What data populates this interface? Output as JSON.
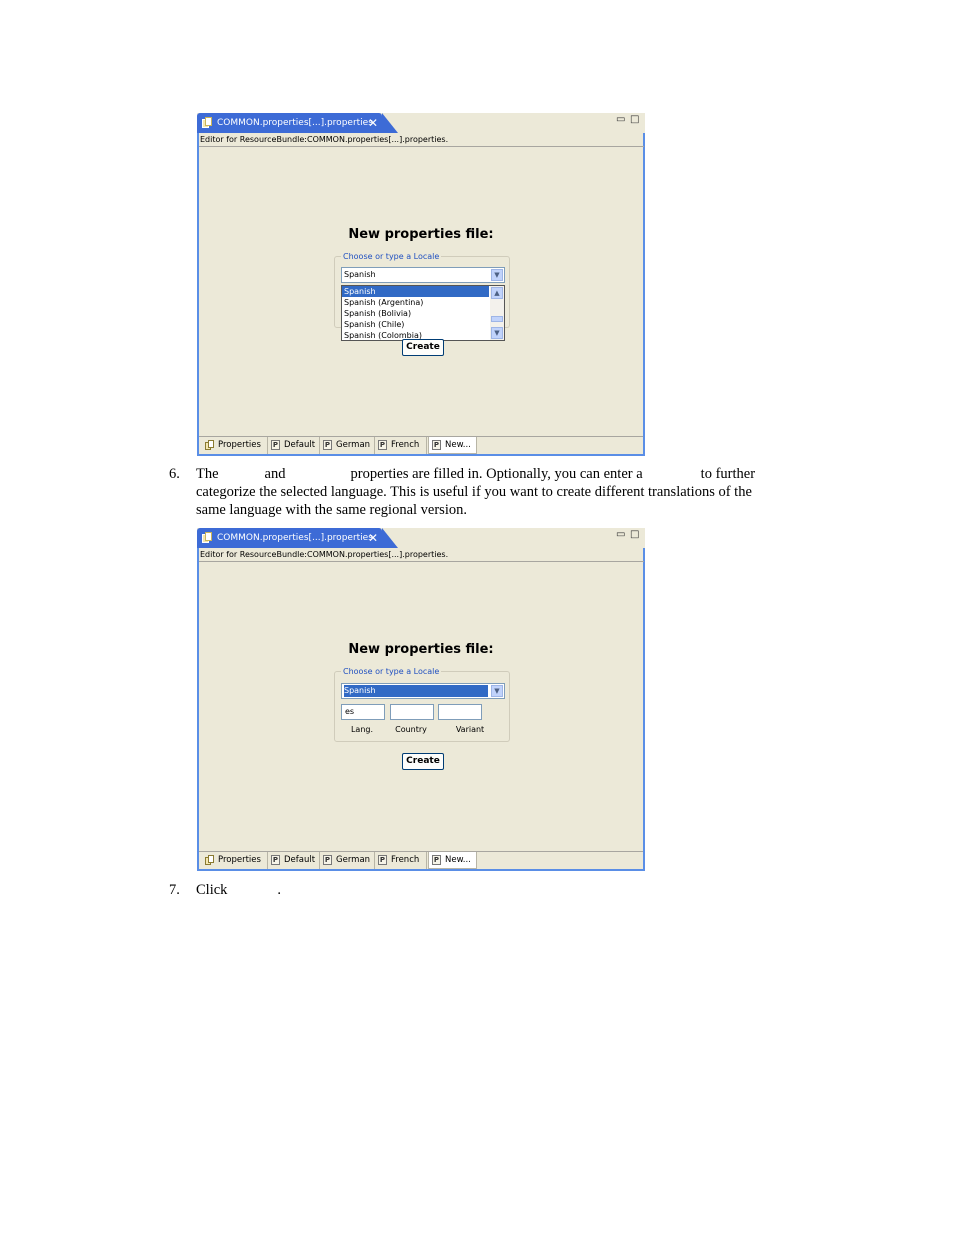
{
  "screenshot_top": {
    "tab_title": "COMMON.properties[...].properties",
    "editor_header": "Editor for ResourceBundle:COMMON.properties[...].properties.",
    "panel_title": "New properties file:",
    "group_label": "Choose or type a Locale",
    "combo_value": "Spanish",
    "dropdown_items": [
      "Spanish",
      "Spanish (Argentina)",
      "Spanish (Bolivia)",
      "Spanish (Chile)",
      "Spanish (Colombia)"
    ],
    "create_button": "Create",
    "bottom_tabs": [
      "Properties",
      "Default",
      "German",
      "French",
      "New..."
    ]
  },
  "step6": {
    "number": "6.",
    "line1_parts": [
      "The",
      "and",
      "properties are filled in.  Optionally, you can enter a",
      "to further"
    ],
    "line2": "categorize the selected language.  This is useful if you want to create different translations of the",
    "line3": "same language with the same regional version."
  },
  "screenshot_bottom": {
    "tab_title": "COMMON.properties[...].properties",
    "editor_header": "Editor for ResourceBundle:COMMON.properties[...].properties.",
    "panel_title": "New properties file:",
    "group_label": "Choose or type a Locale",
    "combo_value": "Spanish",
    "lang_value": "es",
    "country_value": "",
    "variant_value": "",
    "lang_label": "Lang.",
    "country_label": "Country",
    "variant_label": "Variant",
    "create_button": "Create",
    "bottom_tabs": [
      "Properties",
      "Default",
      "German",
      "French",
      "New..."
    ]
  },
  "step7": {
    "number": "7.",
    "text_before": "Click",
    "text_after": "."
  },
  "colors": {
    "tab_active": "#3d6bd6",
    "editor_border": "#5a8ee6",
    "panel_bg": "#ece9d8",
    "selection": "#316ac5"
  }
}
